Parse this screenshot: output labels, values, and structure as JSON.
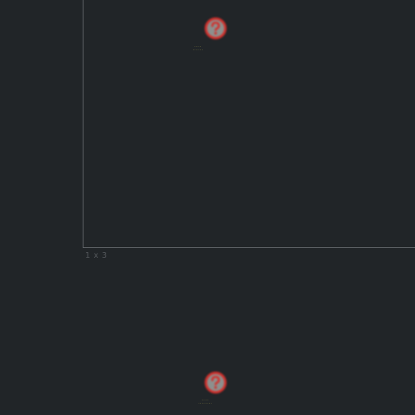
{
  "grid": {
    "cell_label": "1 x 3"
  },
  "markers": [
    {
      "id": "marker-top",
      "icon": "unknown-question-icon",
      "caption_line1": "· · · ·",
      "caption_line2": "· · · · · ·"
    },
    {
      "id": "marker-bottom",
      "icon": "unknown-question-icon",
      "caption_line1": "· · · ·",
      "caption_line2": "· · · · · · · ·"
    }
  ],
  "colors": {
    "background": "#212528",
    "frame": "#5e6266",
    "label": "#53575b",
    "marker_ring": "#d2302c",
    "marker_fill": "#8d908e",
    "caption": "#e6d75a"
  }
}
